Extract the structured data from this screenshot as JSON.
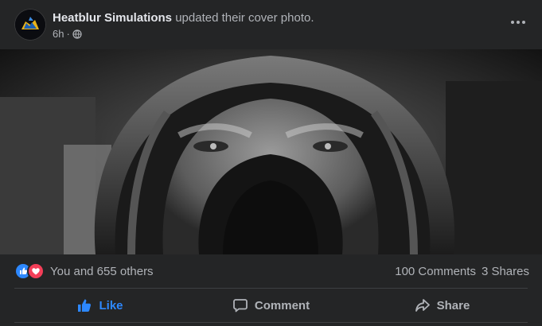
{
  "post": {
    "author": "Heatblur Simulations",
    "action_text": "updated their cover photo.",
    "time": "6h",
    "separator": "·",
    "privacy_icon": "globe-icon",
    "more_icon": "more-options-icon"
  },
  "photo": {
    "style": "black-and-white"
  },
  "reactions": {
    "icons": [
      "like-reaction-icon",
      "love-reaction-icon"
    ],
    "summary": "You and 655 others",
    "comments": "100 Comments",
    "shares": "3 Shares"
  },
  "actions": {
    "like": "Like",
    "comment": "Comment",
    "share": "Share"
  },
  "colors": {
    "background": "#242526",
    "accent": "#2d88ff",
    "love": "#f33e58",
    "text_primary": "#e4e6eb",
    "text_secondary": "#b0b3b8"
  }
}
